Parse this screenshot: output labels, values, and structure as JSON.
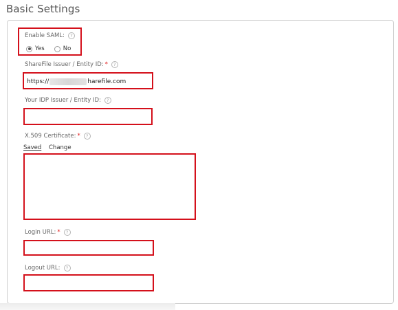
{
  "page": {
    "title": "Basic Settings"
  },
  "saml": {
    "enable_label": "Enable SAML:",
    "help": "?",
    "options": [
      {
        "label": "Yes",
        "selected": true
      },
      {
        "label": "No",
        "selected": false
      }
    ]
  },
  "issuer": {
    "label": "ShareFile Issuer / Entity ID:",
    "required": "*",
    "value_prefix": "https://",
    "value_suffix": "harefile.com"
  },
  "idp": {
    "label": "Your IDP Issuer / Entity ID:",
    "value": ""
  },
  "cert": {
    "label": "X.509 Certificate:",
    "required": "*",
    "tabs": {
      "saved": "Saved",
      "change": "Change"
    },
    "value": ""
  },
  "login": {
    "label": "Login URL:",
    "required": "*",
    "value": ""
  },
  "logout": {
    "label": "Logout URL:",
    "value": ""
  },
  "colors": {
    "highlight": "#d4101b",
    "required": "#e01b1b",
    "border": "#d0d0d0"
  }
}
